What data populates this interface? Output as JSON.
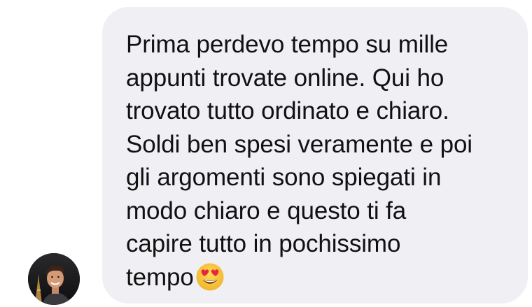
{
  "message": {
    "lines": [
      "Prima perdevo tempo su mille",
      "appunti trovate online. Qui ho",
      "trovato tutto ordinato e chiaro.",
      "Soldi ben spesi veramente e poi",
      "gli argomenti sono spiegati in",
      "modo chiaro e questo ti fa",
      "capire tutto in pochissimo",
      "tempo"
    ],
    "emoji": "heart-eyes-emoji"
  },
  "avatar": {
    "icon": "profile-photo"
  },
  "colors": {
    "bubble": "#efeff4",
    "text": "#111111",
    "emoji_face": "#f7c33a",
    "emoji_hearts": "#e8253c"
  }
}
